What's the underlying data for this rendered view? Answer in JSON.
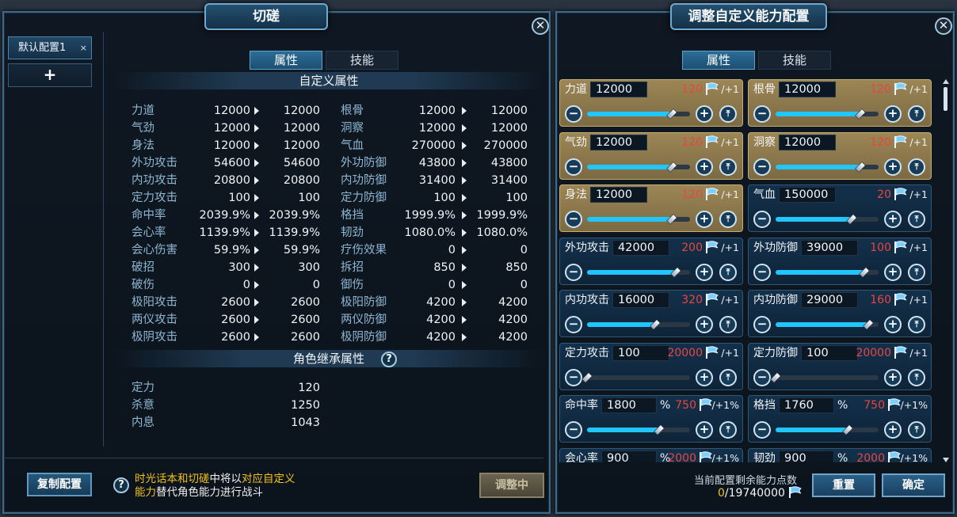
{
  "left": {
    "title": "切磋",
    "config_tab": "默认配置1",
    "config_tab_close": "×",
    "add_config": "+",
    "tabs": [
      "属性",
      "技能"
    ],
    "section_custom": "自定义属性",
    "stats_left": [
      {
        "name": "力道",
        "old": "12000",
        "new": "12000"
      },
      {
        "name": "气劲",
        "old": "12000",
        "new": "12000"
      },
      {
        "name": "身法",
        "old": "12000",
        "new": "12000"
      },
      {
        "name": "外功攻击",
        "old": "54600",
        "new": "54600"
      },
      {
        "name": "内功攻击",
        "old": "20800",
        "new": "20800"
      },
      {
        "name": "定力攻击",
        "old": "100",
        "new": "100"
      },
      {
        "name": "命中率",
        "old": "2039.9%",
        "new": "2039.9%"
      },
      {
        "name": "会心率",
        "old": "1139.9%",
        "new": "1139.9%"
      },
      {
        "name": "会心伤害",
        "old": "59.9%",
        "new": "59.9%"
      },
      {
        "name": "破招",
        "old": "300",
        "new": "300"
      },
      {
        "name": "破伤",
        "old": "0",
        "new": "0"
      },
      {
        "name": "极阳攻击",
        "old": "2600",
        "new": "2600"
      },
      {
        "name": "两仪攻击",
        "old": "2600",
        "new": "2600"
      },
      {
        "name": "极阴攻击",
        "old": "2600",
        "new": "2600"
      }
    ],
    "stats_right": [
      {
        "name": "根骨",
        "old": "12000",
        "new": "12000"
      },
      {
        "name": "洞察",
        "old": "12000",
        "new": "12000"
      },
      {
        "name": "气血",
        "old": "270000",
        "new": "270000"
      },
      {
        "name": "外功防御",
        "old": "43800",
        "new": "43800"
      },
      {
        "name": "内功防御",
        "old": "31400",
        "new": "31400"
      },
      {
        "name": "定力防御",
        "old": "100",
        "new": "100"
      },
      {
        "name": "格挡",
        "old": "1999.9%",
        "new": "1999.9%"
      },
      {
        "name": "韧劲",
        "old": "1080.0%",
        "new": "1080.0%"
      },
      {
        "name": "疗伤效果",
        "old": "0",
        "new": "0"
      },
      {
        "name": "拆招",
        "old": "850",
        "new": "850"
      },
      {
        "name": "御伤",
        "old": "0",
        "new": "0"
      },
      {
        "name": "极阳防御",
        "old": "4200",
        "new": "4200"
      },
      {
        "name": "两仪防御",
        "old": "4200",
        "new": "4200"
      },
      {
        "name": "极阴防御",
        "old": "4200",
        "new": "4200"
      }
    ],
    "section_inherit": "角色继承属性",
    "help": "?",
    "inherited": [
      {
        "name": "定力",
        "value": "120"
      },
      {
        "name": "杀意",
        "value": "1250"
      },
      {
        "name": "内息",
        "value": "1043"
      }
    ],
    "copy_button": "复制配置",
    "tip_part1": "时光话本和切磋",
    "tip_part2": "中将以",
    "tip_part3": "对应自定义能力",
    "tip_part4": "替代角色能力进行战斗",
    "adjusting_button": "调整中"
  },
  "right": {
    "title": "调整自定义能力配置",
    "tabs": [
      "属性",
      "技能"
    ],
    "accent_gold": "#9c8655",
    "accent_blue": "#22c6ff",
    "cards": [
      {
        "label": "力道",
        "value": "12000",
        "points": "120",
        "inc": "/+1",
        "gold": true,
        "level": 0.82
      },
      {
        "label": "根骨",
        "value": "12000",
        "points": "120",
        "inc": "/+1",
        "gold": true,
        "level": 0.82
      },
      {
        "label": "气劲",
        "value": "12000",
        "points": "120",
        "inc": "/+1",
        "gold": true,
        "level": 0.82
      },
      {
        "label": "洞察",
        "value": "12000",
        "points": "120",
        "inc": "/+1",
        "gold": true,
        "level": 0.82
      },
      {
        "label": "身法",
        "value": "12000",
        "points": "120",
        "inc": "/+1",
        "gold": true,
        "level": 0.82
      },
      {
        "label": "气血",
        "value": "150000",
        "points": "20",
        "inc": "/+1",
        "gold": false,
        "level": 0.74
      },
      {
        "label": "外功攻击",
        "value": "42000",
        "points": "200",
        "inc": "/+1",
        "gold": false,
        "level": 0.86
      },
      {
        "label": "外功防御",
        "value": "39000",
        "points": "100",
        "inc": "/+1",
        "gold": false,
        "level": 0.86
      },
      {
        "label": "内功攻击",
        "value": "16000",
        "points": "320",
        "inc": "/+1",
        "gold": false,
        "level": 0.66
      },
      {
        "label": "内功防御",
        "value": "29000",
        "points": "160",
        "inc": "/+1",
        "gold": false,
        "level": 0.9
      },
      {
        "label": "定力攻击",
        "value": "100",
        "points": "20000",
        "inc": "/+1",
        "gold": false,
        "level": 0.0
      },
      {
        "label": "定力防御",
        "value": "100",
        "points": "20000",
        "inc": "/+1",
        "gold": false,
        "level": 0.0
      },
      {
        "label": "命中率",
        "value": "1800",
        "unit": "%",
        "points": "750",
        "inc": "/+1%",
        "gold": false,
        "level": 0.7
      },
      {
        "label": "格挡",
        "value": "1760",
        "unit": "%",
        "points": "750",
        "inc": "/+1%",
        "gold": false,
        "level": 0.7
      },
      {
        "label": "会心率",
        "value": "900",
        "unit": "%",
        "points": "2000",
        "inc": "/+1%",
        "gold": false,
        "level": 0.45
      },
      {
        "label": "韧劲",
        "value": "900",
        "unit": "%",
        "points": "2000",
        "inc": "/+1%",
        "gold": false,
        "level": 0.45
      }
    ],
    "remain_label": "当前配置剩余能力点数",
    "remain_used": "0",
    "remain_total": "/19740000",
    "reset_button": "重置",
    "confirm_button": "确定"
  }
}
